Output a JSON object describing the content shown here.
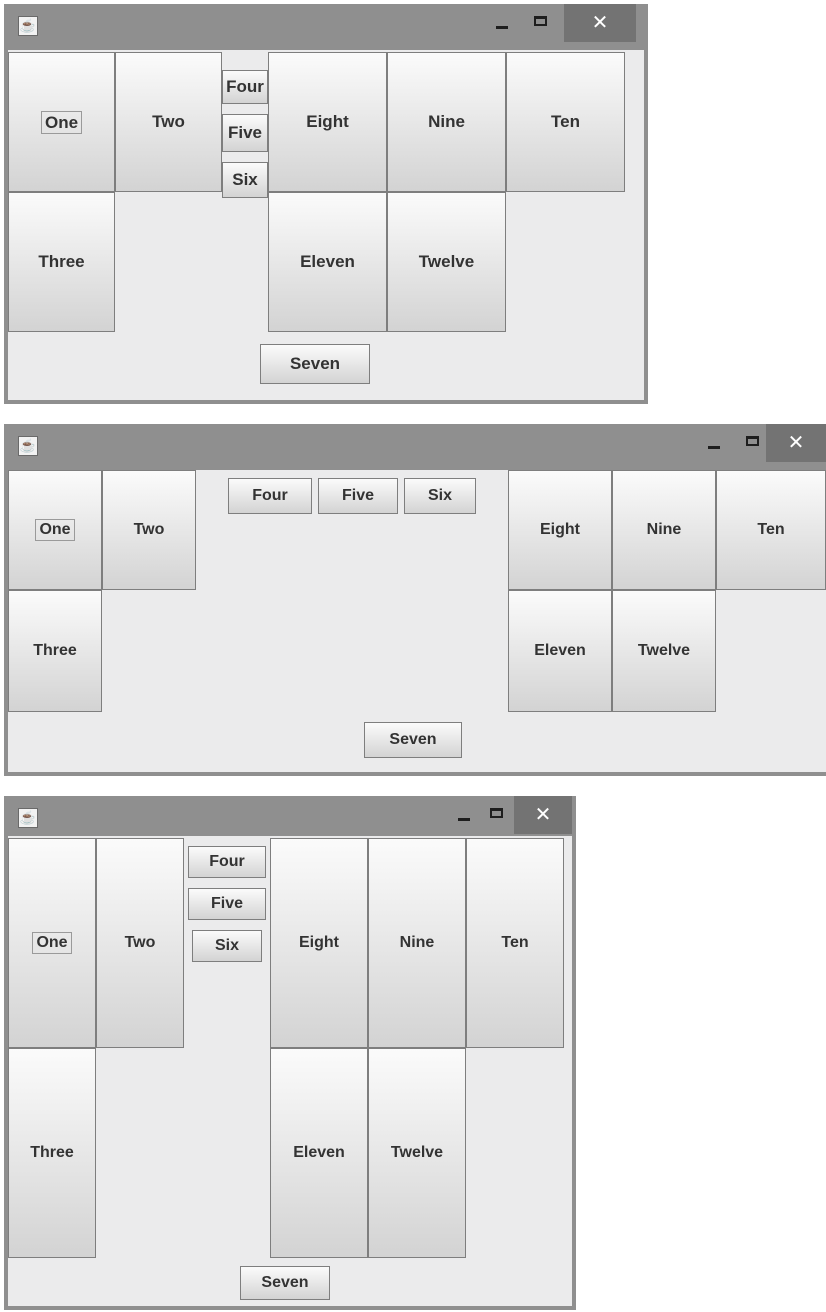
{
  "windows": [
    {
      "buttons": {
        "one": "One",
        "two": "Two",
        "three": "Three",
        "four": "Four",
        "five": "Five",
        "six": "Six",
        "seven": "Seven",
        "eight": "Eight",
        "nine": "Nine",
        "ten": "Ten",
        "eleven": "Eleven",
        "twelve": "Twelve"
      },
      "title_buttons": {
        "close": "✕"
      }
    },
    {
      "buttons": {
        "one": "One",
        "two": "Two",
        "three": "Three",
        "four": "Four",
        "five": "Five",
        "six": "Six",
        "seven": "Seven",
        "eight": "Eight",
        "nine": "Nine",
        "ten": "Ten",
        "eleven": "Eleven",
        "twelve": "Twelve"
      },
      "title_buttons": {
        "close": "✕"
      }
    },
    {
      "buttons": {
        "one": "One",
        "two": "Two",
        "three": "Three",
        "four": "Four",
        "five": "Five",
        "six": "Six",
        "seven": "Seven",
        "eight": "Eight",
        "nine": "Nine",
        "ten": "Ten",
        "eleven": "Eleven",
        "twelve": "Twelve"
      },
      "title_buttons": {
        "close": "✕"
      }
    }
  ],
  "icons": {
    "app": "java-coffee-cup-icon",
    "minimize": "minimize-icon",
    "maximize": "maximize-icon",
    "close": "close-icon"
  }
}
